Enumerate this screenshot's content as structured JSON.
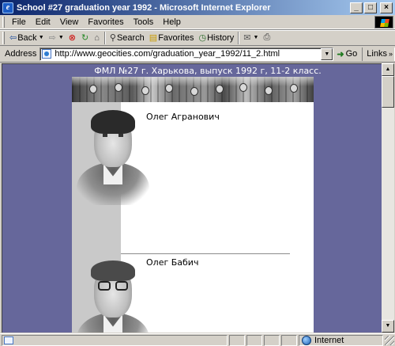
{
  "window": {
    "title": "School #27 graduation year 1992 - Microsoft Internet Explorer",
    "buttons": {
      "minimize": "_",
      "maximize": "□",
      "close": "×"
    }
  },
  "menu": [
    "File",
    "Edit",
    "View",
    "Favorites",
    "Tools",
    "Help"
  ],
  "toolbar": {
    "back": "Back",
    "search": "Search",
    "favorites": "Favorites",
    "history": "History"
  },
  "address": {
    "label": "Address",
    "url": "http://www.geocities.com/graduation_year_1992/11_2.html",
    "go": "Go",
    "links": "Links"
  },
  "page": {
    "heading": "ФМЛ №27 г. Харькова, выпуск 1992 г, 11-2 класс.",
    "people": [
      {
        "name": "Олег Агранович",
        "glasses": false
      },
      {
        "name": "Олег Бабич",
        "glasses": true
      }
    ],
    "colors": {
      "background": "#66679b",
      "strip": "#c9c9c9"
    }
  },
  "status": {
    "zone": "Internet"
  }
}
